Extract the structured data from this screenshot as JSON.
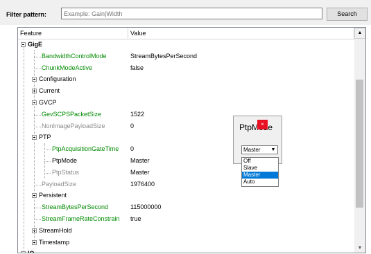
{
  "filter": {
    "label": "Filter pattern:",
    "placeholder": "Example: Gain|Width",
    "search_label": "Search"
  },
  "tree": {
    "columns": [
      "Feature",
      "Value"
    ],
    "rows": [
      {
        "label": "GigE",
        "value": "",
        "style": "black",
        "bold": true,
        "expander": "minus",
        "depth": 0
      },
      {
        "label": "BandwidthControlMode",
        "value": "StreamBytesPerSecond",
        "style": "green",
        "depth": 1
      },
      {
        "label": "ChunkModeActive",
        "value": "false",
        "style": "green",
        "depth": 1
      },
      {
        "label": "Configuration",
        "value": "",
        "style": "black",
        "expander": "plus",
        "depth": 1
      },
      {
        "label": "Current",
        "value": "",
        "style": "black",
        "expander": "plus",
        "depth": 1
      },
      {
        "label": "GVCP",
        "value": "",
        "style": "black",
        "expander": "plus",
        "depth": 1
      },
      {
        "label": "GevSCPSPacketSize",
        "value": "1522",
        "style": "green",
        "depth": 1
      },
      {
        "label": "NonImagePayloadSize",
        "value": "0",
        "style": "gray",
        "depth": 1
      },
      {
        "label": "PTP",
        "value": "",
        "style": "black",
        "expander": "minus",
        "depth": 1
      },
      {
        "label": "PtpAcquisitionGateTime",
        "value": "0",
        "style": "green",
        "depth": 2
      },
      {
        "label": "PtpMode",
        "value": "Master",
        "style": "black",
        "depth": 2,
        "selected": true
      },
      {
        "label": "PtpStatus",
        "value": "Master",
        "style": "gray",
        "depth": 2
      },
      {
        "label": "PayloadSize",
        "value": "1976400",
        "style": "gray",
        "depth": 1
      },
      {
        "label": "Persistent",
        "value": "",
        "style": "black",
        "expander": "plus",
        "depth": 1
      },
      {
        "label": "StreamBytesPerSecond",
        "value": "115000000",
        "style": "green",
        "depth": 1
      },
      {
        "label": "StreamFrameRateConstrain",
        "value": "true",
        "style": "green",
        "depth": 1
      },
      {
        "label": "StreamHold",
        "value": "",
        "style": "black",
        "expander": "plus",
        "depth": 1
      },
      {
        "label": "Timestamp",
        "value": "",
        "style": "black",
        "expander": "plus",
        "depth": 1
      },
      {
        "label": "IO",
        "value": "",
        "style": "black",
        "bold": true,
        "expander": "plus",
        "depth": 0
      }
    ]
  },
  "popup": {
    "title": "PtpMode",
    "close_glyph": "×",
    "selected_value": "Master",
    "options": [
      "Off",
      "Slave",
      "Master",
      "Auto"
    ],
    "highlighted": "Master"
  },
  "scrollbar": {
    "up_glyph": "▲",
    "down_glyph": "▼"
  },
  "colors": {
    "green": "#008a00",
    "gray": "#8a8a8a",
    "highlight": "#0078d7",
    "close": "#e81123"
  }
}
